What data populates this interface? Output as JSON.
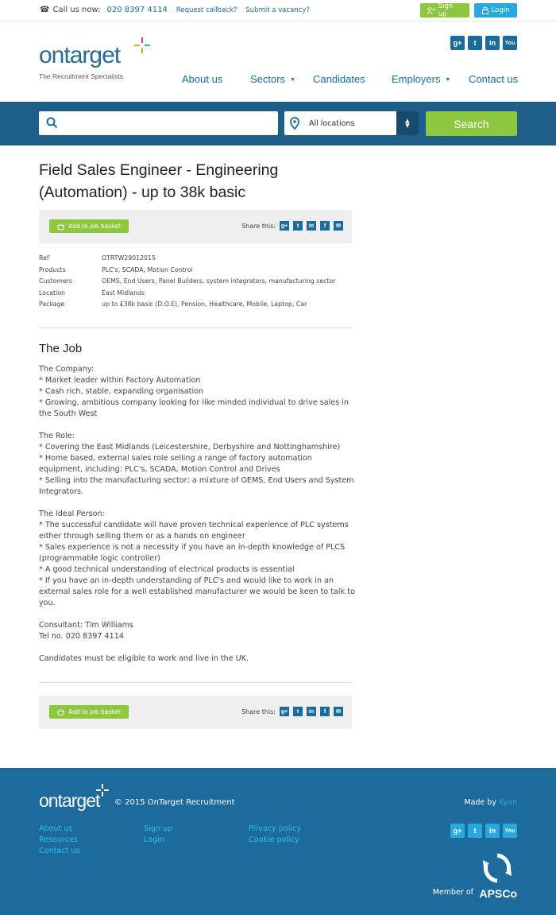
{
  "topbar": {
    "call_label": "Call us now:",
    "phone": "020 8397 4114",
    "request_callback": "Request callback?",
    "submit_vacancy": "Submit a vacancy?",
    "signup": "Sign up",
    "login": "Login"
  },
  "header": {
    "logo_word": "ontarget",
    "logo_tag": "The Recruitment Specialists",
    "nav": [
      "About us",
      "Sectors",
      "Candidates",
      "Employers",
      "Contact us"
    ],
    "social_icons": [
      "google-plus-icon",
      "twitter-icon",
      "linkedin-icon",
      "youtube-icon"
    ]
  },
  "search": {
    "query": "",
    "location": "All locations",
    "button": "Search"
  },
  "job": {
    "title_line1": "Field Sales Engineer - Engineering",
    "title_line2": "(Automation) - up to 38k basic",
    "add_basket": "Add to job basket",
    "share_label": "Share this:",
    "meta": [
      {
        "key": "Ref",
        "value": "OTRTW29012015"
      },
      {
        "key": "Products",
        "value": "PLC's, SCADA, Motion Control"
      },
      {
        "key": "Customers",
        "value": "OEMS, End Users, Panel Builders, system integrators, manufacturing sector"
      },
      {
        "key": "Location",
        "value": "East Midlands"
      },
      {
        "key": "Package",
        "value": "up to £38k basic (D.O.E), Pension, Healthcare, Mobile, Laptop, Car"
      }
    ],
    "section_heading": "The Job",
    "body": [
      "The Company:",
      "* Market leader within Factory Automation",
      "* Cash rich, stable, expanding organisation",
      "* Growing, ambitious company looking for like minded individual to drive sales in the South West",
      "",
      "The Role:",
      "* Covering the East Midlands (Leicestershire, Derbyshire and Nottinghamshire)",
      "* Home based, external sales role selling a range of factory automation equipment, including: PLC's, SCADA, Motion Control and Drives",
      "* Selling into the manufacturing sector; a mixture of OEMS, End Users and System Integrators.",
      "",
      "The Ideal Person:",
      "* The successful candidate will have proven technical experience of PLC systems either through selling them or as a hands on engineer",
      "* Sales experience is not a necessity if you have an in-depth knowledge of PLCS (programmable logic controller)",
      "* A good technical understanding of electrical products is essential",
      "* If you have an in-depth understanding of PLC's and would like to work in an external sales role for a well established manufacturer we would be keen to talk to you.",
      "",
      "Consultant: Tim Williams",
      "Tel no. 020 8397 4114",
      "",
      "Candidates must be eligible to work and live in the UK."
    ]
  },
  "footer": {
    "logo_word": "ontarget",
    "copyright": "© 2015 OnTarget Recruitment",
    "made_by": "Made by",
    "made_by_link": "Kyan",
    "col1": [
      "About us",
      "Resources",
      "Contact us"
    ],
    "col2": [
      "Sign up",
      "Login"
    ],
    "col3": [
      "Privacy policy",
      "Cookie policy"
    ],
    "member_of": "Member of",
    "apsco": "APSCo"
  },
  "colors": {
    "brand_blue": "#1d6a9c",
    "search_band": "#1e5f87",
    "accent_green": "#8dc63f",
    "accent_light_blue": "#29a8e0"
  }
}
